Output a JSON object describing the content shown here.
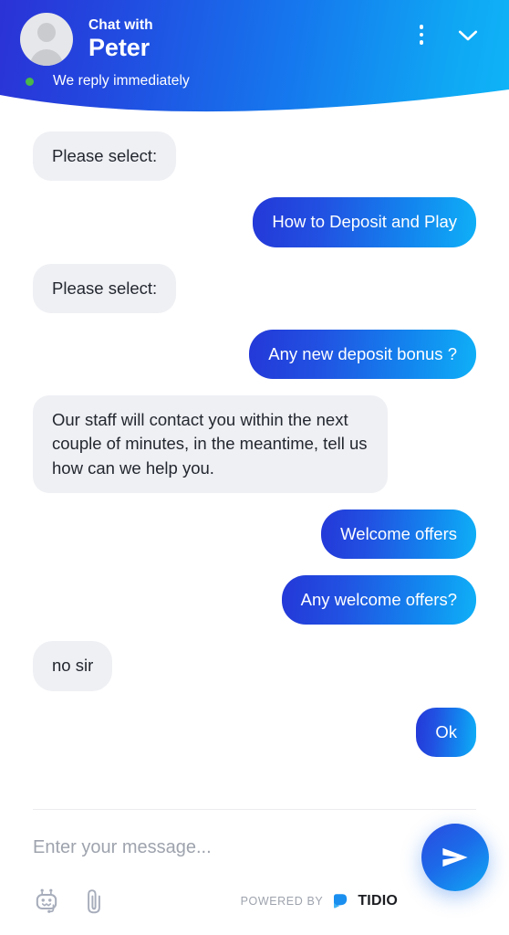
{
  "header": {
    "chat_with_label": "Chat with",
    "agent_name": "Peter",
    "status_text": "We reply immediately",
    "status_dot_color": "#49b749",
    "gradient_start": "#2b32d6",
    "gradient_end": "#0fb4f7",
    "avatar_icon": "default-user-avatar",
    "menu_icon": "three-dots-vertical-icon",
    "minimize_icon": "chevron-down-icon"
  },
  "conversation": {
    "messages": [
      {
        "id": 1,
        "direction": "in",
        "text": "Please select:"
      },
      {
        "id": 2,
        "direction": "out",
        "text": "How to Deposit and Play"
      },
      {
        "id": 3,
        "direction": "in",
        "text": "Please select:"
      },
      {
        "id": 4,
        "direction": "out",
        "text": "Any new deposit bonus ?"
      },
      {
        "id": 5,
        "direction": "in",
        "text": "Our staff will contact you within the next couple of minutes, in the meantime, tell us how can we help you."
      },
      {
        "id": 6,
        "direction": "out",
        "text": "Welcome offers"
      },
      {
        "id": 7,
        "direction": "out",
        "text": "Any welcome offers?"
      },
      {
        "id": 8,
        "direction": "in",
        "text": "no sir"
      },
      {
        "id": 9,
        "direction": "out",
        "text": "Ok"
      }
    ],
    "incoming_bubble_color": "#eff0f4",
    "incoming_text_color": "#23272f",
    "outgoing_gradient_start": "#2438d8",
    "outgoing_gradient_end": "#0fb0f7"
  },
  "composer": {
    "placeholder": "Enter your message...",
    "value": "",
    "bot_icon": "robot-icon",
    "attachment_icon": "paperclip-icon",
    "send_icon": "send-paper-plane-icon",
    "send_button_gradient_start": "#2b4ae0",
    "send_button_gradient_end": "#10aaf5"
  },
  "branding": {
    "powered_by_label": "POWERED BY",
    "brand_name": "TIDIO",
    "logo_icon": "tidio-logo-icon",
    "logo_color": "#1a8ff0"
  }
}
